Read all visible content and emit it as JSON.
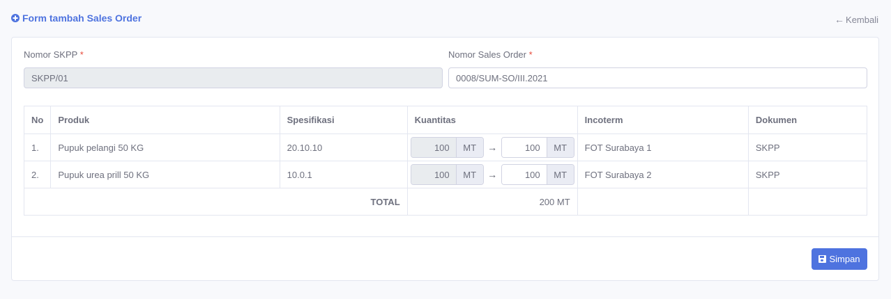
{
  "header": {
    "title": "Form tambah Sales Order",
    "back_label": "Kembali"
  },
  "form": {
    "skpp_label": "Nomor SKPP",
    "skpp_value": "SKPP/01",
    "so_label": "Nomor Sales Order",
    "so_value": "0008/SUM-SO/III.2021",
    "required_mark": "*"
  },
  "table": {
    "headers": [
      "No",
      "Produk",
      "Spesifikasi",
      "Kuantitas",
      "Incoterm",
      "Dokumen"
    ],
    "rows": [
      {
        "no": "1.",
        "produk": "Pupuk pelangi 50 KG",
        "spesifikasi": "20.10.10",
        "qty_from": "100",
        "qty_to": "100",
        "unit": "MT",
        "incoterm": "FOT Surabaya 1",
        "dokumen": "SKPP"
      },
      {
        "no": "2.",
        "produk": "Pupuk urea prill 50 KG",
        "spesifikasi": "10.0.1",
        "qty_from": "100",
        "qty_to": "100",
        "unit": "MT",
        "incoterm": "FOT Surabaya 2",
        "dokumen": "SKPP"
      }
    ],
    "total_label": "TOTAL",
    "total_value": "200 MT"
  },
  "footer": {
    "save_label": "Simpan"
  },
  "colors": {
    "primary": "#4e73df",
    "required": "#e74a3b"
  }
}
